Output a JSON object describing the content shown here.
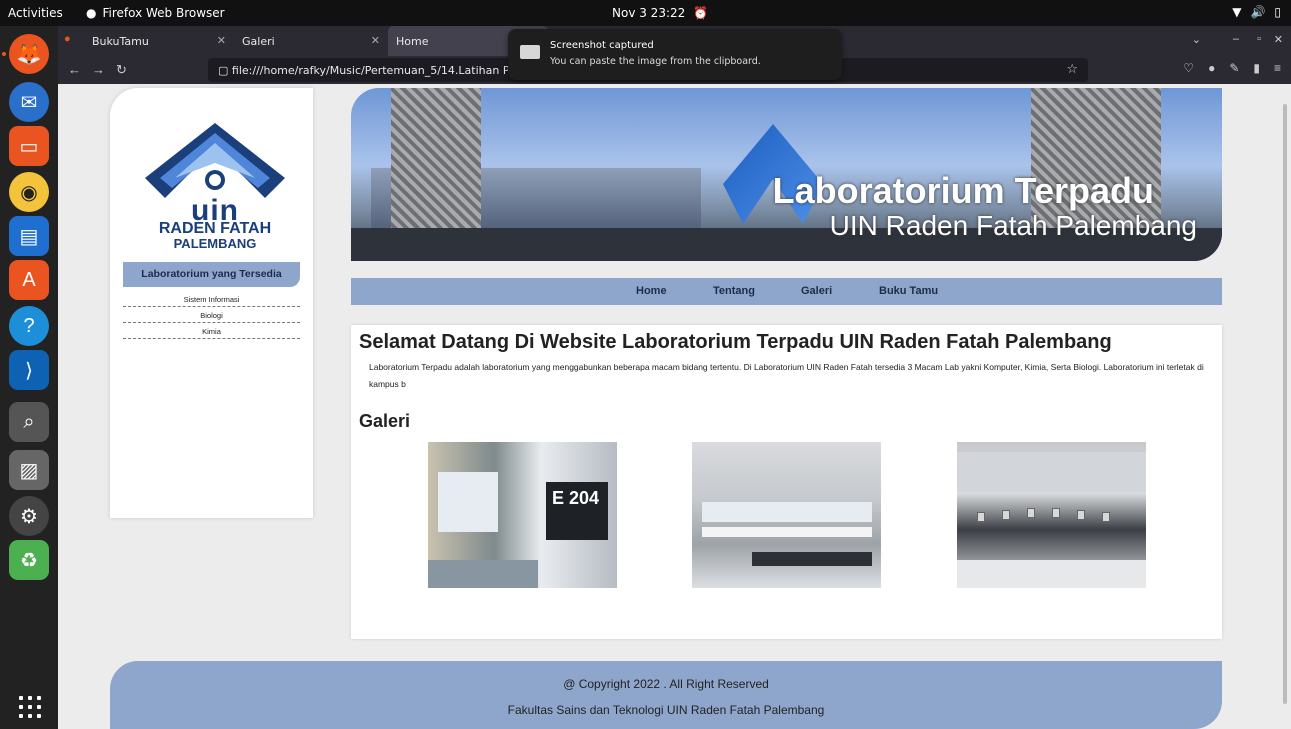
{
  "system_bar": {
    "activities": "Activities",
    "app_name": "Firefox Web Browser",
    "clock": "Nov 3  23:22"
  },
  "browser": {
    "tabs": [
      {
        "label": "BukuTamu"
      },
      {
        "label": "Galeri"
      },
      {
        "label": "Home"
      }
    ],
    "url": "file:///home/rafky/Music/Pertemuan_5/14.Latihan Position"
  },
  "notification": {
    "title": "Screenshot captured",
    "body": "You can paste the image from the clipboard."
  },
  "page": {
    "logo": {
      "text_main": "uin",
      "text_line2": "RADEN FATAH",
      "text_line3": "PALEMBANG"
    },
    "sidebar": {
      "heading": "Laboratorium yang Tersedia",
      "items": [
        "Sistem Informasi",
        "Biologi",
        "Kimia"
      ]
    },
    "banner": {
      "title": "Laboratorium Terpadu",
      "subtitle": "UIN Raden Fatah Palembang"
    },
    "nav": [
      "Home",
      "Tentang",
      "Galeri",
      "Buku Tamu"
    ],
    "content": {
      "heading": "Selamat Datang Di Website Laboratorium Terpadu UIN Raden Fatah Palembang",
      "intro": "Laboratorium Terpadu adalah laboratorium yang menggabunkan beberapa macam bidang tertentu. Di Laboratorium UIN Raden Fatah tersedia 3 Macam Lab yakni Komputer, Kimia, Serta Biologi. Laboratorium ini terletak di kampus b",
      "gallery_heading": "Galeri",
      "photo_sign": "E 204"
    },
    "footer": {
      "line1": "@ Copyright 2022 . All Right Reserved",
      "line2": "Fakultas Sains dan Teknologi UIN Raden Fatah Palembang"
    }
  }
}
